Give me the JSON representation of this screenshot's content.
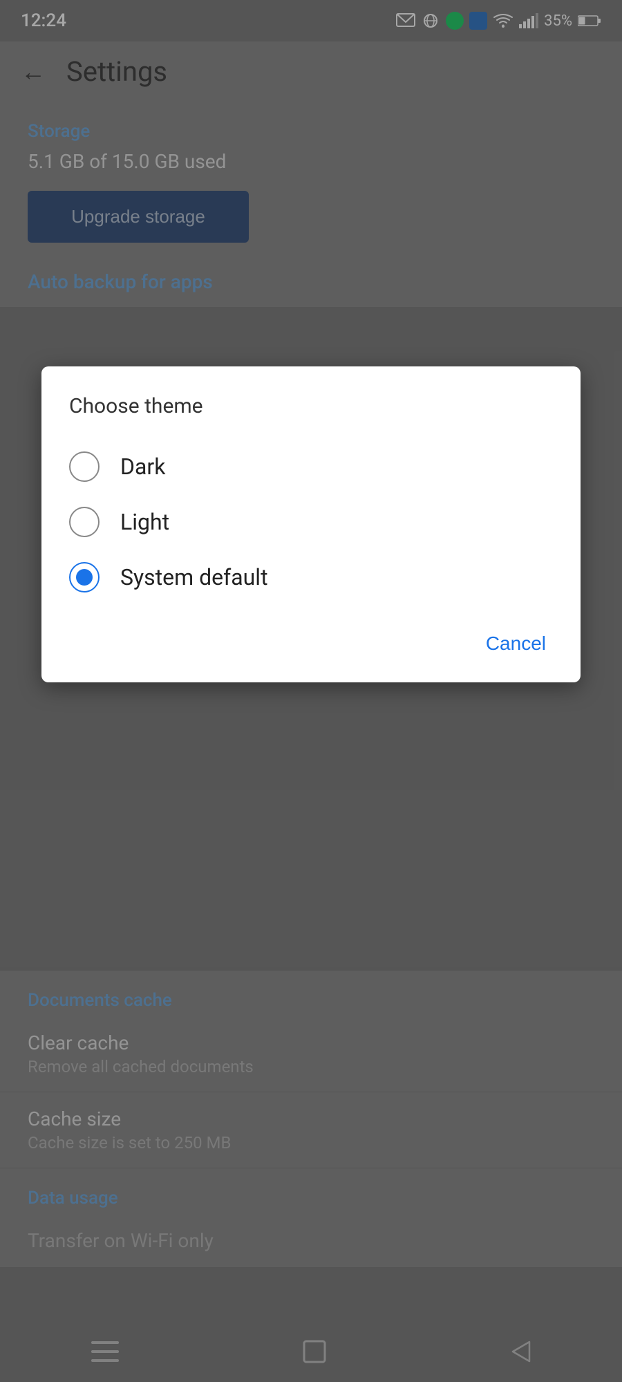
{
  "statusBar": {
    "time": "12:24",
    "batteryPercent": "35%",
    "icons": [
      "message-icon",
      "vpn-icon",
      "green-circle-icon",
      "blue-flag-icon"
    ]
  },
  "header": {
    "backLabel": "←",
    "title": "Settings"
  },
  "storage": {
    "sectionLabel": "Storage",
    "usedText": "5.1 GB of 15.0 GB used",
    "upgradeButton": "Upgrade storage"
  },
  "autoBackup": {
    "sectionLabel": "Auto backup for apps"
  },
  "dialog": {
    "title": "Choose theme",
    "options": [
      {
        "id": "dark",
        "label": "Dark",
        "selected": false
      },
      {
        "id": "light",
        "label": "Light",
        "selected": false
      },
      {
        "id": "system",
        "label": "System default",
        "selected": true
      }
    ],
    "cancelLabel": "Cancel"
  },
  "documentsCache": {
    "sectionLabel": "Documents cache",
    "clearCache": {
      "title": "Clear cache",
      "subtitle": "Remove all cached documents"
    },
    "cacheSize": {
      "title": "Cache size",
      "subtitle": "Cache size is set to 250 MB"
    }
  },
  "dataUsage": {
    "sectionLabel": "Data usage",
    "transferItem": {
      "title": "Transfer on Wi-Fi",
      "subtitle": ""
    }
  },
  "navBar": {
    "icons": [
      "menu-icon",
      "home-icon",
      "back-icon"
    ]
  }
}
